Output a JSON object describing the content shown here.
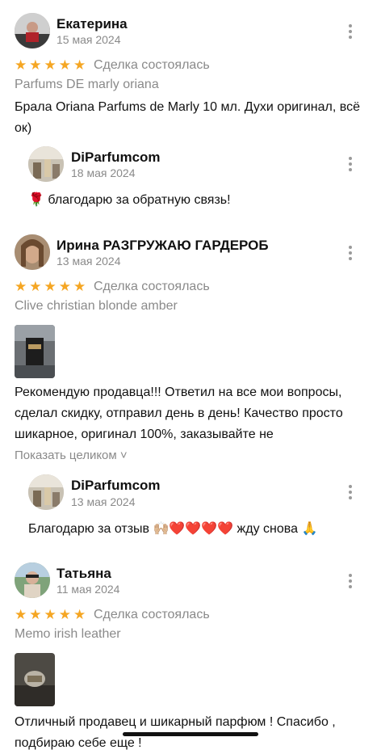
{
  "reviews": [
    {
      "author": "Екатерина",
      "date": "15 мая 2024",
      "stars": "★★★★★",
      "deal_status": "Сделка состоялась",
      "product": "Parfums DE marly oriana",
      "text": "Брала Oriana Parfums de Marly 10 мл. Духи оригинал, всё ок)",
      "reply": {
        "author": "DiParfumcom",
        "date": "18 мая 2024",
        "text": "🌹 благодарю за обратную связь!"
      }
    },
    {
      "author": "Ирина РАЗГРУЖАЮ ГАРДЕРОБ",
      "date": "13 мая 2024",
      "stars": "★★★★★",
      "deal_status": "Сделка состоялась",
      "product": "Clive christian blonde amber",
      "text": "Рекомендую продавца!!! Ответил на все мои вопросы, сделал скидку, отправил день в день! Качество просто шикарное, оригинал 100%, заказывайте не",
      "show_more": "Показать целиком ˅",
      "reply": {
        "author": "DiParfumcom",
        "date": "13 мая 2024",
        "text": "Благодарю за отзыв 🙌🏼❤️❤️❤️❤️ жду снова 🙏"
      }
    },
    {
      "author": "Татьяна",
      "date": "11 мая 2024",
      "stars": "★★★★★",
      "deal_status": "Сделка состоялась",
      "product": "Memo irish leather",
      "text": "Отличный продавец и шикарный  парфюм !  Спасибо , подбираю себе еще !"
    }
  ],
  "colors": {
    "star": "#f5a623",
    "muted": "#8a8a8a",
    "text": "#111111"
  },
  "icons": {
    "menu": "more-vertical-icon"
  }
}
